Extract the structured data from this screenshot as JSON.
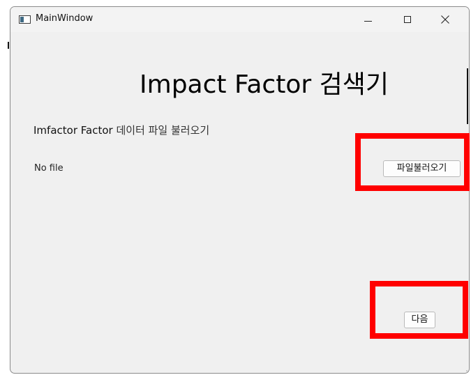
{
  "window": {
    "title": "MainWindow"
  },
  "main": {
    "heading": "Impact Factor 검색기",
    "subtitle_bold": "Imfactor Factor",
    "subtitle_rest": " 데이터 파일 불러오기",
    "file_status": "No file",
    "load_button_label": "파일불러오기",
    "next_button_label": "다음"
  },
  "colors": {
    "window_bg": "#f0f0f0",
    "highlight": "#ff0000",
    "button_bg": "#fdfdfd"
  }
}
